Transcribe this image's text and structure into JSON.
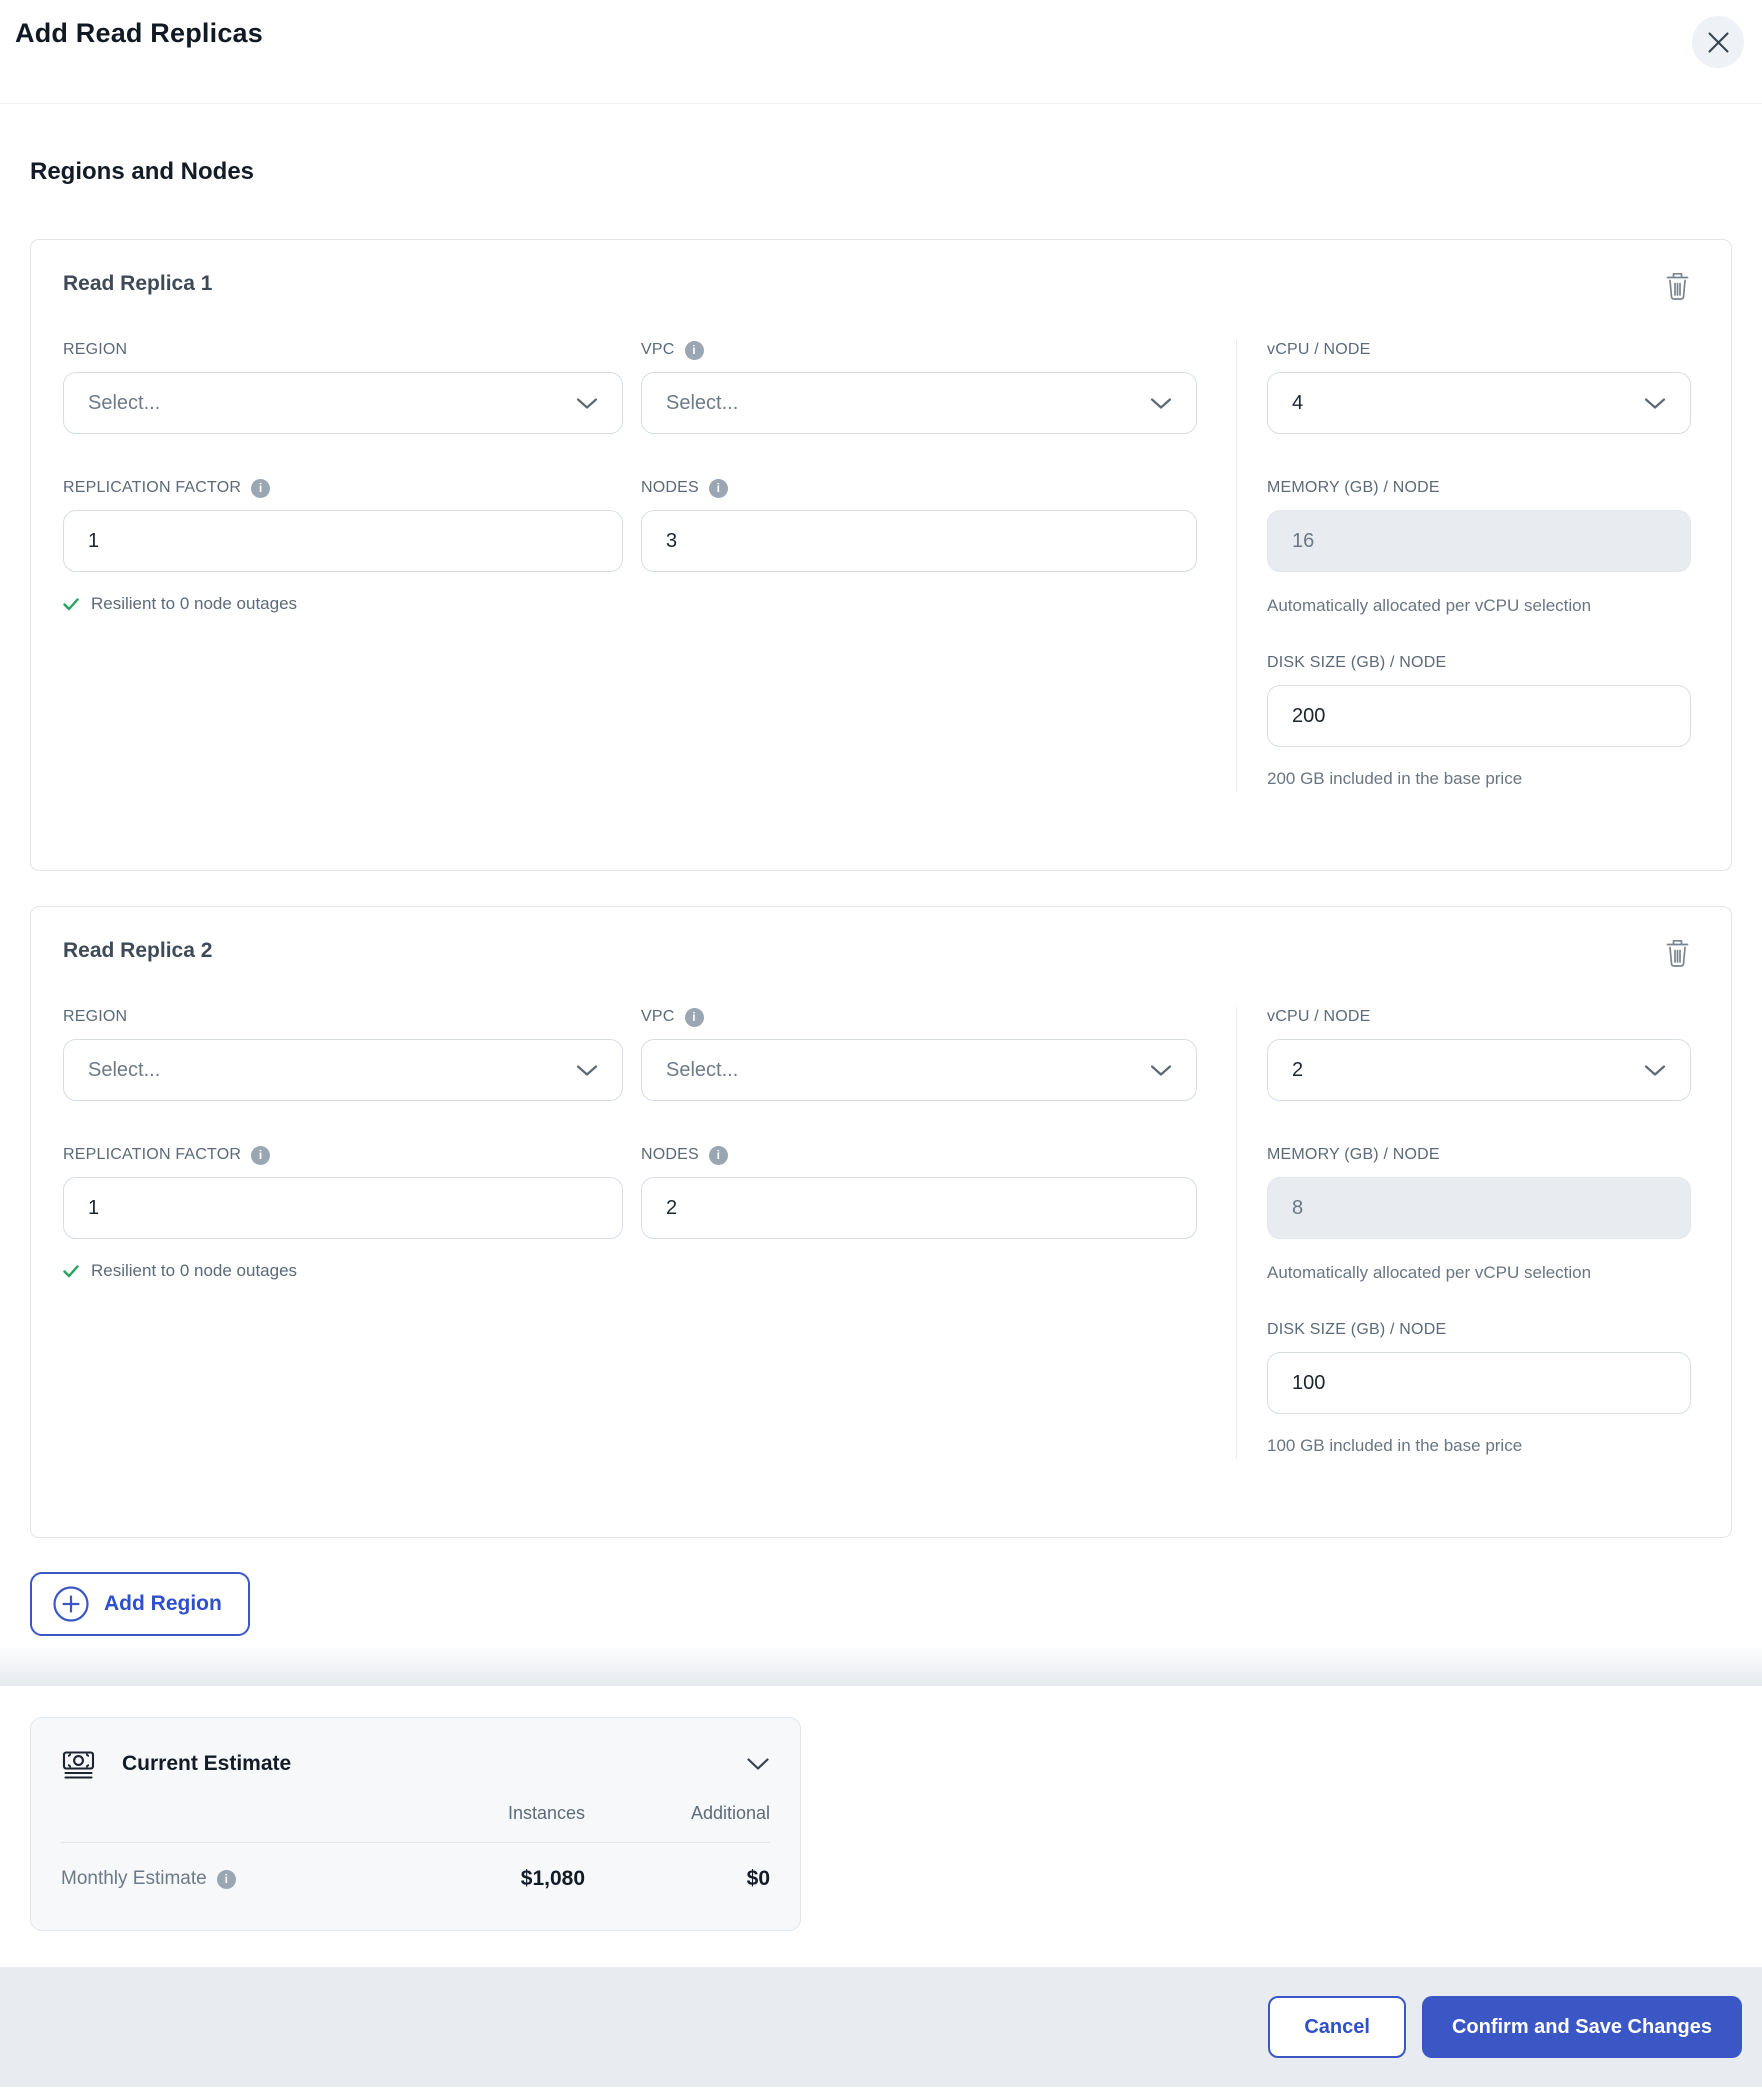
{
  "modal": {
    "title": "Add Read Replicas"
  },
  "section_heading": "Regions and Nodes",
  "replicas": [
    {
      "title": "Read Replica 1",
      "region": {
        "label": "REGION",
        "placeholder": "Select..."
      },
      "vpc": {
        "label": "VPC",
        "placeholder": "Select..."
      },
      "vcpu": {
        "label": "vCPU / NODE",
        "value": "4"
      },
      "replication_factor": {
        "label": "REPLICATION FACTOR",
        "value": "1"
      },
      "nodes": {
        "label": "NODES",
        "value": "3"
      },
      "memory": {
        "label": "MEMORY (GB) / NODE",
        "value": "16",
        "helper": "Automatically allocated per vCPU selection"
      },
      "resilience_note": "Resilient to 0 node outages",
      "disk": {
        "label": "DISK SIZE (GB) / NODE",
        "value": "200",
        "helper": "200 GB included in the base price"
      }
    },
    {
      "title": "Read Replica 2",
      "region": {
        "label": "REGION",
        "placeholder": "Select..."
      },
      "vpc": {
        "label": "VPC",
        "placeholder": "Select..."
      },
      "vcpu": {
        "label": "vCPU / NODE",
        "value": "2"
      },
      "replication_factor": {
        "label": "REPLICATION FACTOR",
        "value": "1"
      },
      "nodes": {
        "label": "NODES",
        "value": "2"
      },
      "memory": {
        "label": "MEMORY (GB) / NODE",
        "value": "8",
        "helper": "Automatically allocated per vCPU selection"
      },
      "resilience_note": "Resilient to 0 node outages",
      "disk": {
        "label": "DISK SIZE (GB) / NODE",
        "value": "100",
        "helper": "100 GB included in the base price"
      }
    }
  ],
  "add_region_label": "Add Region",
  "estimate": {
    "title": "Current Estimate",
    "columns": [
      "Instances",
      "Additional"
    ],
    "rows": [
      {
        "label": "Monthly Estimate",
        "instances": "$1,080",
        "additional": "$0"
      }
    ]
  },
  "footer": {
    "cancel_label": "Cancel",
    "confirm_label": "Confirm and Save Changes"
  },
  "colors": {
    "primary": "#3b57c5",
    "success_green": "#27a25c",
    "footer_bg": "#e8ebf0"
  }
}
